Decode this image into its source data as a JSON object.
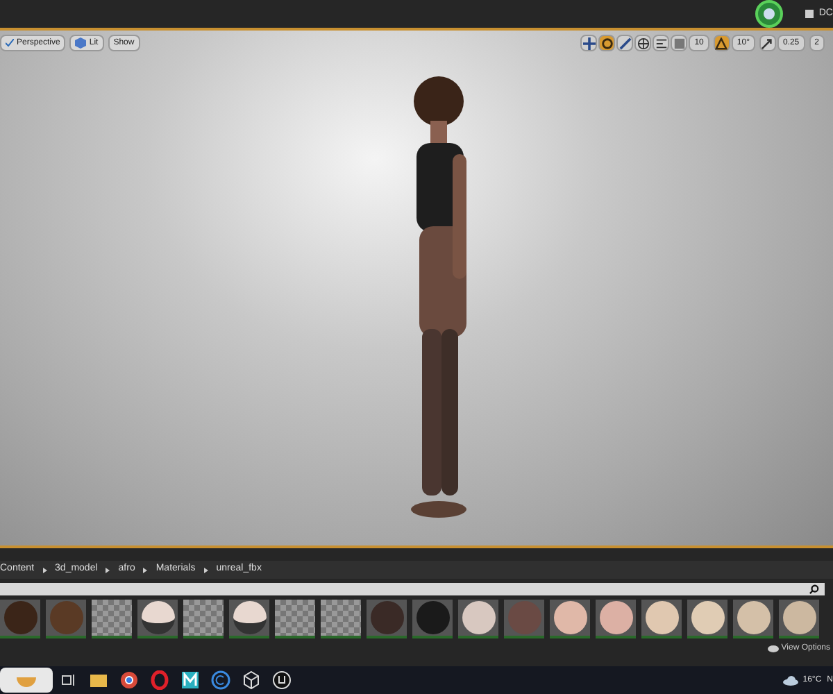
{
  "title_bar": {
    "text": "DC"
  },
  "viewport": {
    "left_buttons": [
      "Perspective",
      "Lit",
      "Show"
    ],
    "right_tools": [
      {
        "kind": "icon",
        "selected": false
      },
      {
        "kind": "icon",
        "selected": true
      },
      {
        "kind": "icon",
        "selected": false
      },
      {
        "kind": "icon",
        "selected": false
      },
      {
        "kind": "icon",
        "selected": false
      },
      {
        "kind": "icon",
        "selected": false
      },
      {
        "kind": "value",
        "label": "10"
      },
      {
        "kind": "icon",
        "selected": true
      },
      {
        "kind": "value",
        "label": "10°"
      },
      {
        "kind": "icon",
        "selected": false
      },
      {
        "kind": "value",
        "label": "0.25"
      },
      {
        "kind": "value",
        "label": "2"
      }
    ]
  },
  "content_browser": {
    "path": [
      "Content",
      "3d_model",
      "afro",
      "Materials",
      "unreal_fbx"
    ],
    "assets": [
      {
        "kind": "material",
        "color": "#3b2518"
      },
      {
        "kind": "material",
        "color": "#5a3a25"
      },
      {
        "kind": "empty"
      },
      {
        "kind": "eye",
        "color": "#e8d8d0"
      },
      {
        "kind": "empty"
      },
      {
        "kind": "eye",
        "color": "#e8d8d0"
      },
      {
        "kind": "empty"
      },
      {
        "kind": "empty"
      },
      {
        "kind": "material",
        "color": "#3a2a26"
      },
      {
        "kind": "material",
        "color": "#1a1a1a"
      },
      {
        "kind": "material",
        "color": "#d8c8c0"
      },
      {
        "kind": "material",
        "color": "#6a4a44"
      },
      {
        "kind": "material",
        "color": "#e0b8a8"
      },
      {
        "kind": "material",
        "color": "#dcb0a4"
      },
      {
        "kind": "material",
        "color": "#e0c8b0"
      },
      {
        "kind": "material",
        "color": "#e0ccb4"
      },
      {
        "kind": "material",
        "color": "#d4c0a8"
      },
      {
        "kind": "material",
        "color": "#ccb8a0"
      }
    ],
    "view_options": "View Options"
  },
  "taskbar": {
    "weather": "16°C",
    "tray_text": "N"
  }
}
